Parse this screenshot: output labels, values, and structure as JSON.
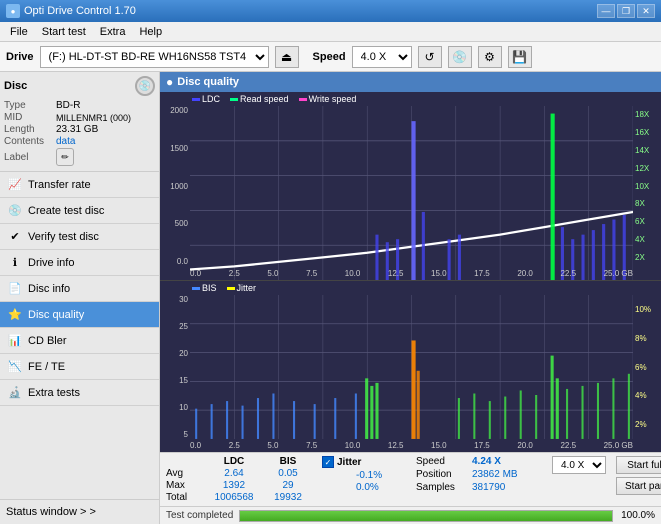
{
  "titlebar": {
    "title": "Opti Drive Control 1.70",
    "min": "—",
    "max": "❐",
    "close": "✕"
  },
  "menubar": {
    "items": [
      "File",
      "Start test",
      "Extra",
      "Help"
    ]
  },
  "drivebar": {
    "drive_label": "Drive",
    "drive_value": "(F:)  HL-DT-ST BD-RE  WH16NS58 TST4",
    "speed_label": "Speed",
    "speed_value": "4.0 X"
  },
  "sidebar": {
    "disc_title": "Disc",
    "disc_fields": [
      {
        "key": "Type",
        "value": "BD-R",
        "color": "normal"
      },
      {
        "key": "MID",
        "value": "MILLENMR1 (000)",
        "color": "normal"
      },
      {
        "key": "Length",
        "value": "23.31 GB",
        "color": "normal"
      },
      {
        "key": "Contents",
        "value": "data",
        "color": "blue"
      },
      {
        "key": "Label",
        "value": "",
        "color": "normal"
      }
    ],
    "buttons": [
      {
        "label": "Transfer rate",
        "active": false,
        "icon": "📈"
      },
      {
        "label": "Create test disc",
        "active": false,
        "icon": "💿"
      },
      {
        "label": "Verify test disc",
        "active": false,
        "icon": "✔"
      },
      {
        "label": "Drive info",
        "active": false,
        "icon": "ℹ"
      },
      {
        "label": "Disc info",
        "active": false,
        "icon": "📄"
      },
      {
        "label": "Disc quality",
        "active": true,
        "icon": "⭐"
      },
      {
        "label": "CD Bler",
        "active": false,
        "icon": "📊"
      },
      {
        "label": "FE / TE",
        "active": false,
        "icon": "📉"
      },
      {
        "label": "Extra tests",
        "active": false,
        "icon": "🔬"
      }
    ],
    "status_window": "Status window > >"
  },
  "quality_panel": {
    "title": "Disc quality",
    "legend": {
      "ldc": "LDC",
      "read": "Read speed",
      "write": "Write speed"
    },
    "upper_chart": {
      "y_left_labels": [
        "2000",
        "1500",
        "1000",
        "500",
        "0.0"
      ],
      "y_right_labels": [
        "18X",
        "16X",
        "14X",
        "12X",
        "10X",
        "8X",
        "6X",
        "4X",
        "2X"
      ],
      "x_labels": [
        "0.0",
        "2.5",
        "5.0",
        "7.5",
        "10.0",
        "12.5",
        "15.0",
        "17.5",
        "20.0",
        "22.5",
        "25.0 GB"
      ]
    },
    "lower_chart": {
      "title_left": "BIS",
      "title_right": "Jitter",
      "y_left_labels": [
        "30",
        "25",
        "20",
        "15",
        "10",
        "5"
      ],
      "y_right_labels": [
        "10%",
        "8%",
        "6%",
        "4%",
        "2%"
      ],
      "x_labels": [
        "0.0",
        "2.5",
        "5.0",
        "7.5",
        "10.0",
        "12.5",
        "15.0",
        "17.5",
        "20.0",
        "22.5",
        "25.0 GB"
      ]
    }
  },
  "stats": {
    "headers": [
      "",
      "LDC",
      "BIS",
      "",
      "Jitter",
      "Speed",
      "",
      ""
    ],
    "avg_label": "Avg",
    "avg_ldc": "2.64",
    "avg_bis": "0.05",
    "avg_jitter": "-0.1%",
    "max_label": "Max",
    "max_ldc": "1392",
    "max_bis": "29",
    "max_jitter": "0.0%",
    "total_label": "Total",
    "total_ldc": "1006568",
    "total_bis": "19932",
    "jitter_checked": true,
    "speed_label": "Speed",
    "speed_value": "4.24 X",
    "speed_select": "4.0 X",
    "position_label": "Position",
    "position_value": "23862 MB",
    "samples_label": "Samples",
    "samples_value": "381790",
    "start_full": "Start full",
    "start_part": "Start part"
  },
  "statusbar": {
    "status_text": "Test completed",
    "progress_percent": "100.0%",
    "progress_value": 100
  }
}
